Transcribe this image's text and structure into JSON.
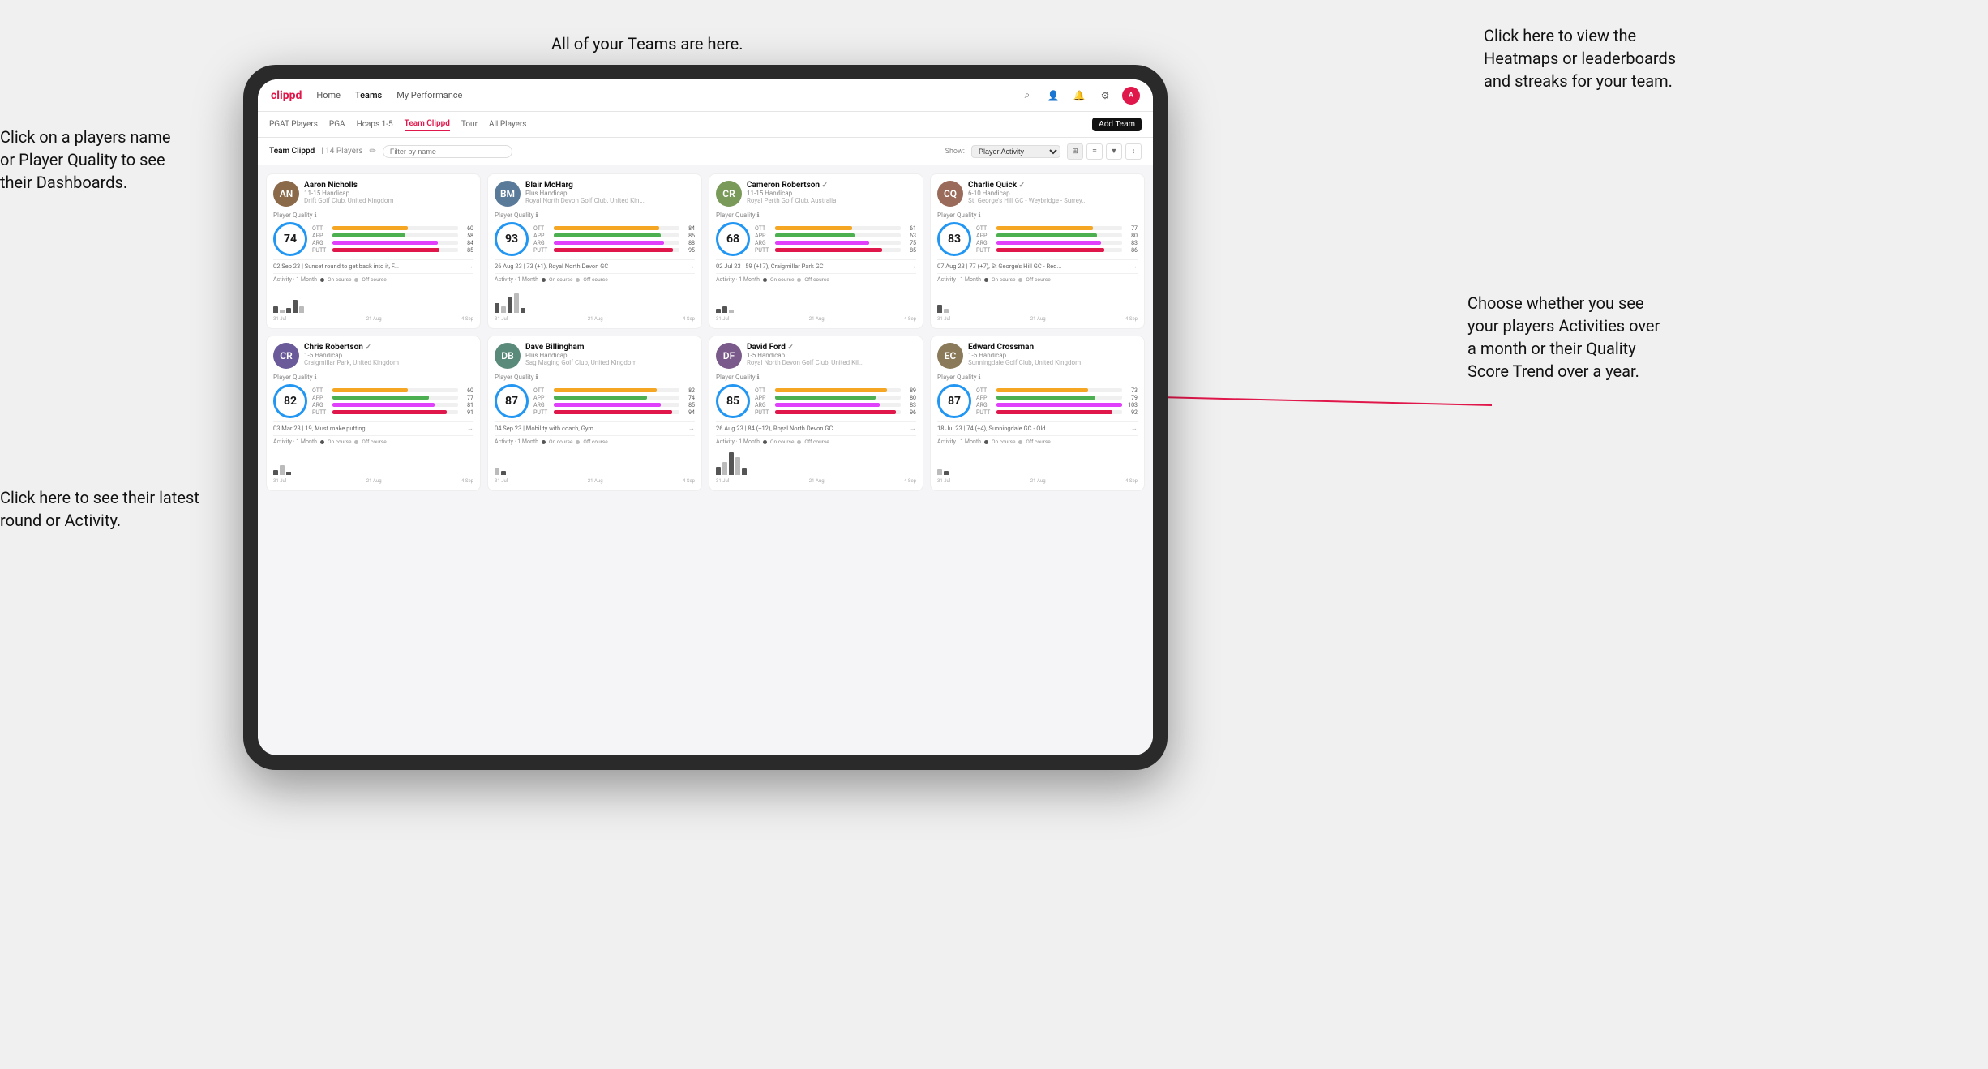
{
  "annotations": {
    "teams_callout": "All of your Teams are here.",
    "heatmaps_callout": "Click here to view the\nHeatmaps or leaderboards\nand streaks for your team.",
    "players_name_callout": "Click on a players name\nor Player Quality to see\ntheir Dashboards.",
    "round_callout": "Click here to see their latest\nround or Activity.",
    "activity_callout": "Choose whether you see\nyour players Activities over\na month or their Quality\nScore Trend over a year."
  },
  "nav": {
    "logo": "clippd",
    "links": [
      "Home",
      "Teams",
      "My Performance"
    ],
    "active_link": "Teams"
  },
  "sub_nav": {
    "links": [
      "PGAT Players",
      "PGA",
      "Hcaps 1-5",
      "Team Clippd",
      "Tour",
      "All Players"
    ],
    "active": "Team Clippd",
    "add_team_label": "Add Team"
  },
  "team_bar": {
    "title": "Team Clippd",
    "player_count": "14 Players",
    "show_label": "Show:",
    "show_value": "Player Activity",
    "search_placeholder": "Filter by name"
  },
  "players": [
    {
      "name": "Aaron Nicholls",
      "handicap": "11-15 Handicap",
      "club": "Drift Golf Club, United Kingdom",
      "quality": 74,
      "ott": 60,
      "app": 58,
      "arg": 84,
      "putt": 85,
      "latest_round": "02 Sep 23 | Sunset round to get back into it, F...",
      "avatar_color": "#8B6A4A",
      "avatar_initials": "AN"
    },
    {
      "name": "Blair McHarg",
      "handicap": "Plus Handicap",
      "club": "Royal North Devon Golf Club, United Kin...",
      "quality": 93,
      "ott": 84,
      "app": 85,
      "arg": 88,
      "putt": 95,
      "latest_round": "26 Aug 23 | 73 (+1), Royal North Devon GC",
      "avatar_color": "#5a7a9a",
      "avatar_initials": "BM"
    },
    {
      "name": "Cameron Robertson",
      "handicap": "11-15 Handicap",
      "club": "Royal Perth Golf Club, Australia",
      "quality": 68,
      "ott": 61,
      "app": 63,
      "arg": 75,
      "putt": 85,
      "latest_round": "02 Jul 23 | 59 (+17), Craigmillar Park GC",
      "avatar_color": "#7a9a5a",
      "avatar_initials": "CR"
    },
    {
      "name": "Charlie Quick",
      "handicap": "6-10 Handicap",
      "club": "St. George's Hill GC - Weybridge - Surrey...",
      "quality": 83,
      "ott": 77,
      "app": 80,
      "arg": 83,
      "putt": 86,
      "latest_round": "07 Aug 23 | 77 (+7), St George's Hill GC - Red...",
      "avatar_color": "#9a6a5a",
      "avatar_initials": "CQ"
    },
    {
      "name": "Chris Robertson",
      "handicap": "1-5 Handicap",
      "club": "Craigmillar Park, United Kingdom",
      "quality": 82,
      "ott": 60,
      "app": 77,
      "arg": 81,
      "putt": 91,
      "latest_round": "03 Mar 23 | 19, Must make putting",
      "avatar_color": "#6a5a9a",
      "avatar_initials": "CR"
    },
    {
      "name": "Dave Billingham",
      "handicap": "Plus Handicap",
      "club": "Sag Maging Golf Club, United Kingdom",
      "quality": 87,
      "ott": 82,
      "app": 74,
      "arg": 85,
      "putt": 94,
      "latest_round": "04 Sep 23 | Mobility with coach, Gym",
      "avatar_color": "#5a8a7a",
      "avatar_initials": "DB"
    },
    {
      "name": "David Ford",
      "handicap": "1-5 Handicap",
      "club": "Royal North Devon Golf Club, United Kil...",
      "quality": 85,
      "ott": 89,
      "app": 80,
      "arg": 83,
      "putt": 96,
      "latest_round": "26 Aug 23 | 84 (+12), Royal North Devon GC",
      "avatar_color": "#7a5a8a",
      "avatar_initials": "DF"
    },
    {
      "name": "Edward Crossman",
      "handicap": "1-5 Handicap",
      "club": "Sunningdale Golf Club, United Kingdom",
      "quality": 87,
      "ott": 73,
      "app": 79,
      "arg": 103,
      "putt": 92,
      "latest_round": "18 Jul 23 | 74 (+4), Sunningdale GC - Old",
      "avatar_color": "#8a7a5a",
      "avatar_initials": "EC"
    }
  ],
  "colors": {
    "brand_red": "#e0174a",
    "ott": "#f5a623",
    "app": "#4caf50",
    "arg": "#e040fb",
    "putt": "#e0174a",
    "on_course": "#555555",
    "off_course": "#bbbbbb"
  }
}
